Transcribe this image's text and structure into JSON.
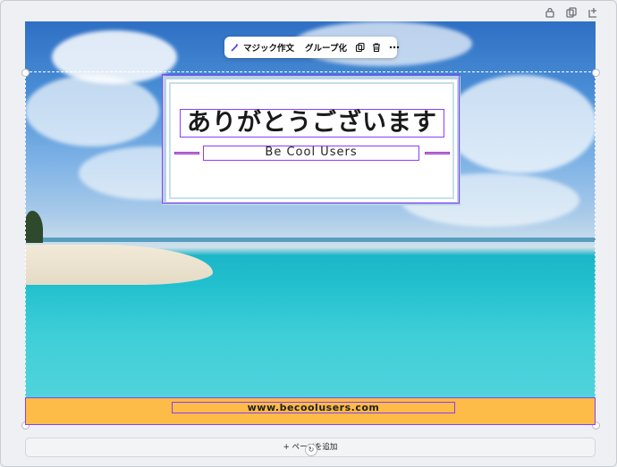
{
  "toolbar": {
    "magic_write_label": "マジック作文",
    "group_label": "グループ化",
    "duplicate_icon": "duplicate-icon",
    "delete_icon": "trash-icon",
    "more_icon": "more-icon"
  },
  "design": {
    "title": "ありがとうございます",
    "subtitle": "Be Cool Users",
    "url": "www.becoolusers.com",
    "footer_color": "#fdbb47",
    "selection_color": "#8b3dff"
  },
  "page_controls": {
    "add_page_label": "+ ページを追加"
  },
  "top_icons": [
    "lock-icon",
    "duplicate-page-icon",
    "add-page-icon"
  ]
}
